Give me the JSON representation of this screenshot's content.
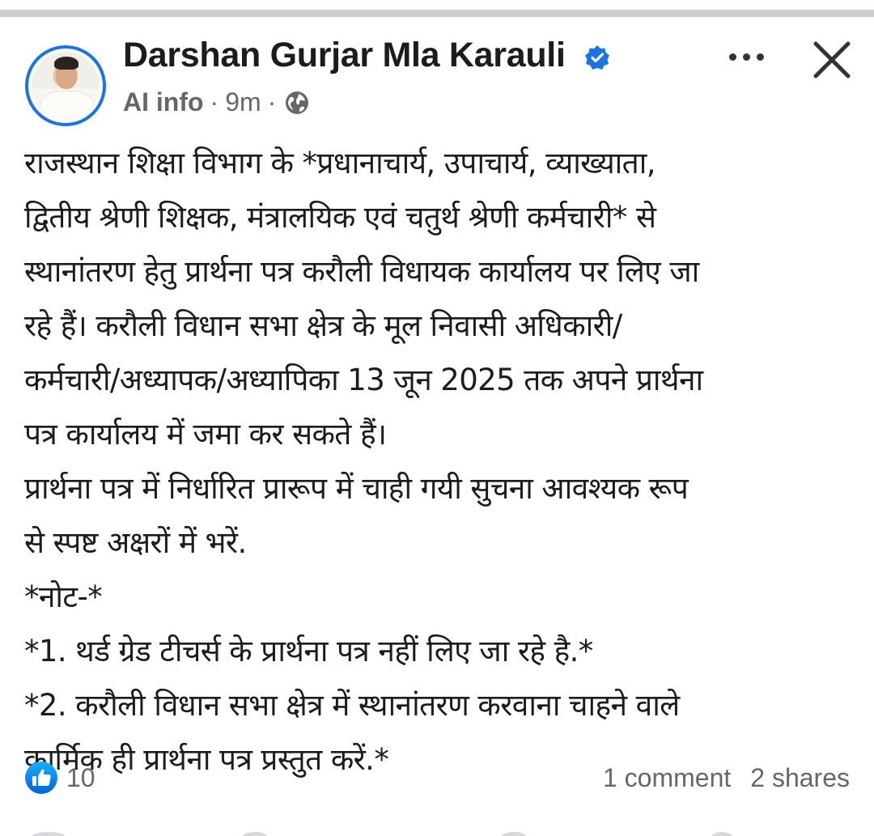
{
  "post": {
    "author": "Darshan Gurjar Mla Karauli",
    "verified_icon": "verified-badge-icon",
    "meta": {
      "label": "AI info",
      "separator": "·",
      "time": "9m",
      "audience_icon": "globe-icon"
    },
    "more_icon": "more-options-icon",
    "close_icon": "close-icon",
    "lines": [
      "राजस्थान शिक्षा विभाग के *प्रधानाचार्य, उपाचार्य, व्याख्याता,",
      "द्वितीय श्रेणी शिक्षक, मंत्रालयिक एवं चतुर्थ श्रेणी कर्मचारी* से",
      "स्थानांतरण हेतु प्रार्थना पत्र  करौली विधायक कार्यालय पर लिए जा",
      "रहे हैं। करौली विधान सभा क्षेत्र के मूल निवासी अधिकारी/",
      "कर्मचारी/अध्यापक/अध्यापिका 13 जून 2025 तक अपने प्रार्थना",
      "पत्र कार्यालय में जमा कर सकते हैं।",
      "प्रार्थना पत्र में निर्धारित प्रारूप में चाही गयी सुचना आवश्यक रूप",
      "से स्पष्ट अक्षरों में भरें.",
      "*नोट-*",
      "*1. थर्ड ग्रेड टीचर्स के प्रार्थना पत्र नहीं लिए जा रहे है.*",
      "*2. करौली विधान सभा क्षेत्र में स्थानांतरण करवाना चाहने वाले",
      "कार्मिक ही प्रार्थना पत्र प्रस्तुत करें.*"
    ],
    "reactions": {
      "icon": "like-icon",
      "count": "10"
    },
    "comments": "1 comment",
    "shares": "2 shares"
  },
  "colors": {
    "accent": "#1b74e4",
    "secondary_text": "#65676b",
    "primary_text": "#1c1c1c"
  }
}
